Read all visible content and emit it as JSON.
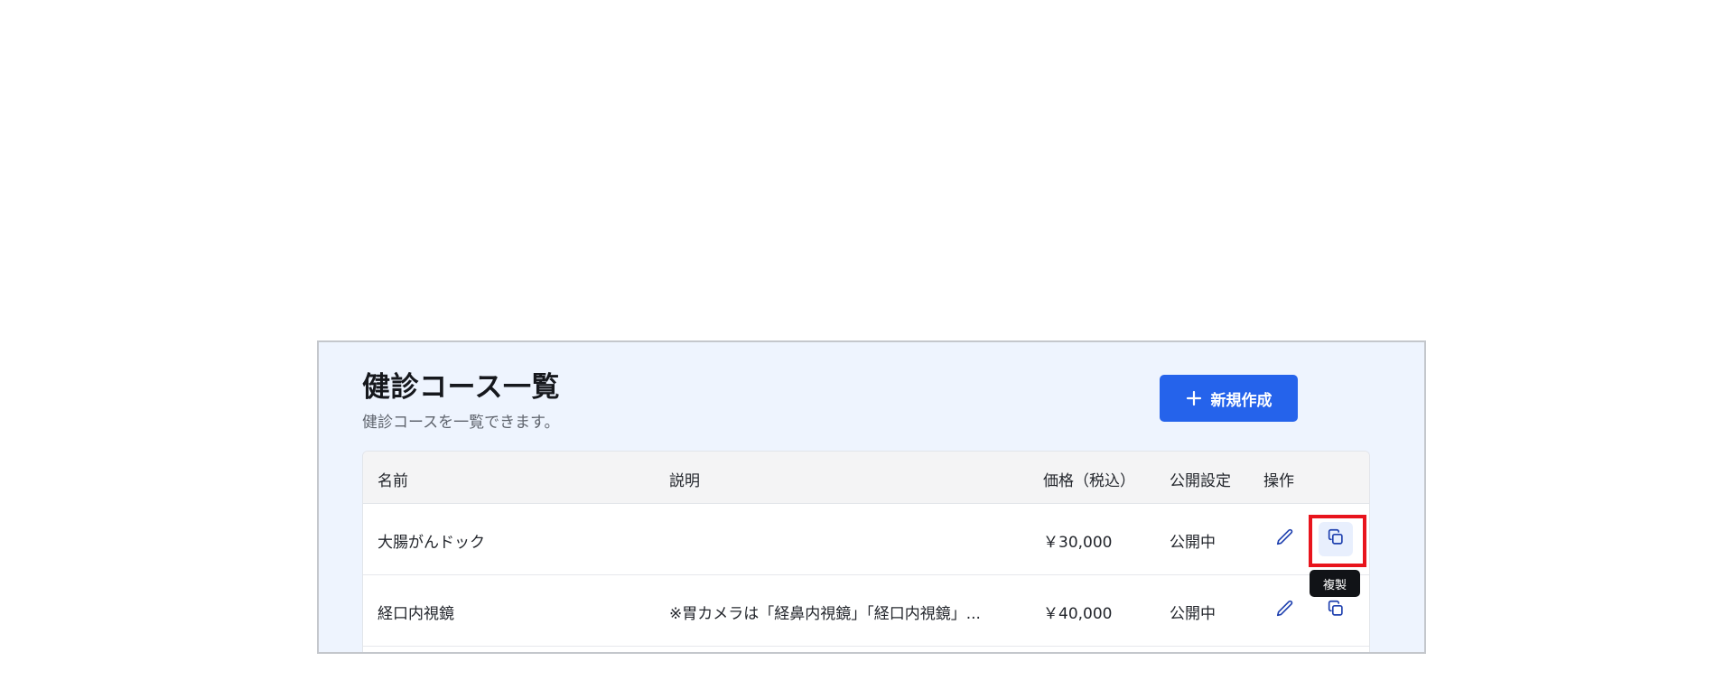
{
  "header": {
    "title": "健診コース一覧",
    "subtitle": "健診コースを一覧できます。",
    "new_button_label": "新規作成"
  },
  "table": {
    "columns": [
      "名前",
      "説明",
      "価格（税込）",
      "公開設定",
      "操作"
    ],
    "rows": [
      {
        "name": "大腸がんドック",
        "description": "",
        "price": "￥30,000",
        "status": "公開中"
      },
      {
        "name": "経口内視鏡",
        "description": "※胃カメラは「経鼻内視鏡」「経口内視鏡」...",
        "price": "￥40,000",
        "status": "公開中"
      }
    ]
  },
  "tooltip": {
    "copy_label": "複製"
  },
  "icons": {
    "add": "plus-icon",
    "edit": "pencil-icon",
    "duplicate": "copy-icon"
  },
  "colors": {
    "accent": "#2563eb",
    "panel_background": "#eef4fe",
    "highlight": "#e8141c",
    "icon": "#1e40af"
  }
}
